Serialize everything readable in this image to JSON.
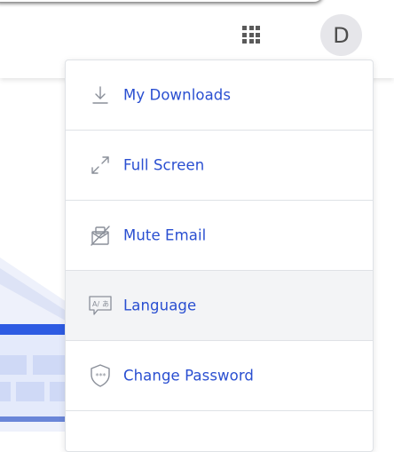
{
  "header": {
    "apps_icon": "apps-grid-icon",
    "avatar_initial": "D"
  },
  "menu": {
    "items": [
      {
        "label": "My Downloads",
        "icon": "download-icon",
        "highlighted": false
      },
      {
        "label": "Full Screen",
        "icon": "expand-icon",
        "highlighted": false
      },
      {
        "label": "Mute Email",
        "icon": "mute-email-icon",
        "highlighted": false
      },
      {
        "label": "Language",
        "icon": "language-icon",
        "highlighted": true
      },
      {
        "label": "Change Password",
        "icon": "shield-password-icon",
        "highlighted": false
      }
    ]
  },
  "colors": {
    "link": "#2a4fd1",
    "icon": "#8a8f99",
    "divider": "#dfe2e6",
    "highlight": "#f3f4f6",
    "avatar_bg": "#e6e6ea"
  }
}
